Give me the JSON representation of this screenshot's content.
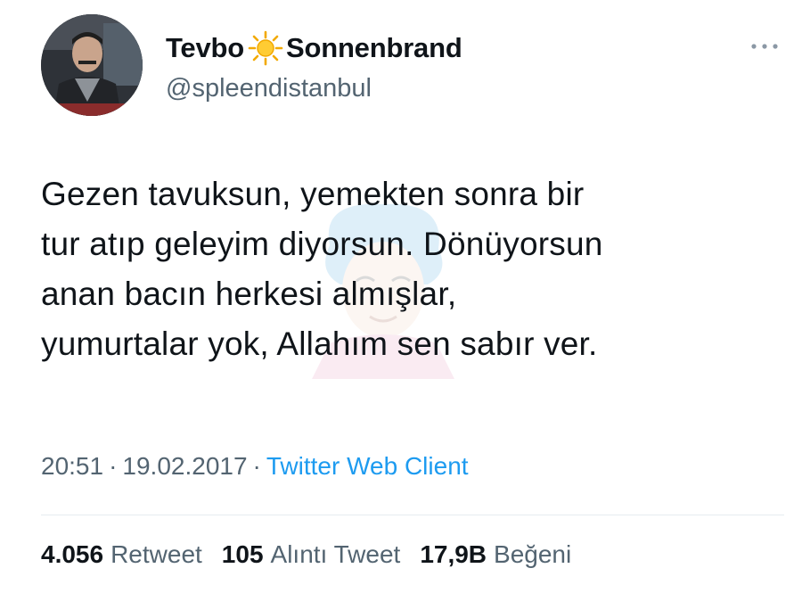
{
  "author": {
    "name_part1": "Tevbo",
    "name_emoji": "sun-icon",
    "name_part2": "Sonnenbrand",
    "handle": "@spleendistanbul"
  },
  "tweet": {
    "lines": [
      "Gezen tavuksun, yemekten sonra bir",
      "tur atıp geleyim diyorsun. Dönüyorsun",
      "anan bacın herkesi almışlar,",
      "yumurtalar yok, Allahım sen sabır ver."
    ]
  },
  "meta": {
    "time": "20:51",
    "separator": "·",
    "date": "19.02.2017",
    "source": "Twitter Web Client"
  },
  "stats": {
    "retweets": {
      "count": "4.056",
      "label": "Retweet"
    },
    "quotes": {
      "count": "105",
      "label": "Alıntı Tweet"
    },
    "likes": {
      "count": "17,9B",
      "label": "Beğeni"
    }
  },
  "colors": {
    "text": "#0f1419",
    "secondary": "#536471",
    "link": "#1d9bf0",
    "divider": "#e6ecf0"
  }
}
